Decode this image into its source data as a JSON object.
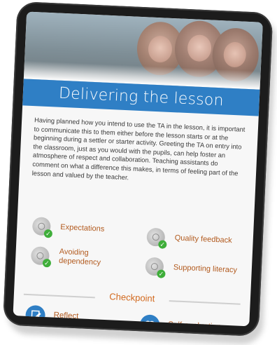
{
  "page": {
    "title": "Delivering the lesson",
    "body": "Having planned how you intend to use the TA in the lesson, it is important to communicate this to them either before the lesson starts or at the beginning during a settler or starter activity. Greeting the TA on entry into the classroom, just as you would with the pupils, can help foster an atmosphere of respect and collaboration. Teaching assistants do comment on what a difference this makes, in terms of feeling part of the lesson and valued by the teacher."
  },
  "features": [
    {
      "label": "Expectations"
    },
    {
      "label": "Quality feedback"
    },
    {
      "label": "Avoiding dependency"
    },
    {
      "label": "Supporting literacy"
    }
  ],
  "checkpoint": {
    "heading": "Checkpoint",
    "items": [
      {
        "label": "Reflect",
        "icon": "edit-icon"
      },
      {
        "label": "Self-evaluation",
        "icon": "heart-icon"
      }
    ]
  },
  "colors": {
    "accent": "#2f7fc5",
    "label": "#b25a1e",
    "checkpoint": "#d2691e",
    "check": "#3fae3a"
  }
}
